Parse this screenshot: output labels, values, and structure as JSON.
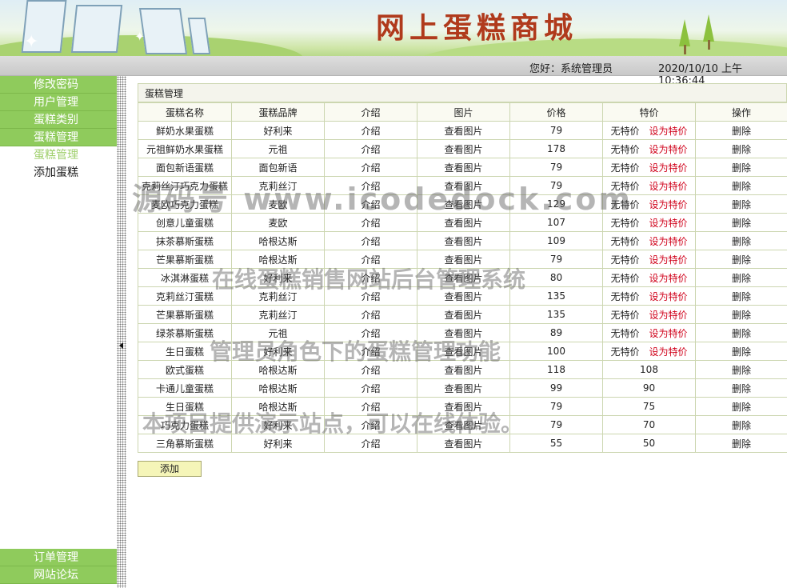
{
  "header": {
    "site_title": "网上蛋糕商城",
    "greeting": "您好：系统管理员",
    "datetime": "2020/10/10 上午10:36:44"
  },
  "sidebar": {
    "items": [
      {
        "label": "修改密码"
      },
      {
        "label": "用户管理"
      },
      {
        "label": "蛋糕类别"
      },
      {
        "label": "蛋糕管理"
      }
    ],
    "subitems": [
      {
        "label": "蛋糕管理",
        "active": true
      },
      {
        "label": "添加蛋糕",
        "active": false
      }
    ],
    "bottom_items": [
      {
        "label": "订单管理"
      },
      {
        "label": "网站论坛"
      }
    ]
  },
  "panel": {
    "title": "蛋糕管理",
    "columns": [
      "蛋糕名称",
      "蛋糕品牌",
      "介绍",
      "图片",
      "价格",
      "特价",
      "操作"
    ],
    "intro_link": "介绍",
    "image_link": "查看图片",
    "no_special": "无特价",
    "set_special": "设为特价",
    "delete_label": "删除",
    "rows": [
      {
        "name": "鲜奶水果蛋糕",
        "brand": "好利来",
        "price": "79",
        "special": ""
      },
      {
        "name": "元祖鲜奶水果蛋糕",
        "brand": "元祖",
        "price": "178",
        "special": ""
      },
      {
        "name": "面包新语蛋糕",
        "brand": "面包新语",
        "price": "79",
        "special": ""
      },
      {
        "name": "克莉丝汀巧克力蛋糕",
        "brand": "克莉丝汀",
        "price": "79",
        "special": ""
      },
      {
        "name": "麦欧巧克力蛋糕",
        "brand": "麦欧",
        "price": "129",
        "special": ""
      },
      {
        "name": "创意儿童蛋糕",
        "brand": "麦欧",
        "price": "107",
        "special": ""
      },
      {
        "name": "抹茶慕斯蛋糕",
        "brand": "哈根达斯",
        "price": "109",
        "special": ""
      },
      {
        "name": "芒果慕斯蛋糕",
        "brand": "哈根达斯",
        "price": "79",
        "special": ""
      },
      {
        "name": "冰淇淋蛋糕",
        "brand": "好利来",
        "price": "80",
        "special": ""
      },
      {
        "name": "克莉丝汀蛋糕",
        "brand": "克莉丝汀",
        "price": "135",
        "special": ""
      },
      {
        "name": "芒果慕斯蛋糕",
        "brand": "克莉丝汀",
        "price": "135",
        "special": ""
      },
      {
        "name": "绿茶慕斯蛋糕",
        "brand": "元祖",
        "price": "89",
        "special": ""
      },
      {
        "name": "生日蛋糕",
        "brand": "好利来",
        "price": "100",
        "special": ""
      },
      {
        "name": "欧式蛋糕",
        "brand": "哈根达斯",
        "price": "118",
        "special": "108"
      },
      {
        "name": "卡通儿童蛋糕",
        "brand": "哈根达斯",
        "price": "99",
        "special": "90"
      },
      {
        "name": "生日蛋糕",
        "brand": "哈根达斯",
        "price": "79",
        "special": "75"
      },
      {
        "name": "巧克力蛋糕",
        "brand": "好利来",
        "price": "79",
        "special": "70"
      },
      {
        "name": "三角慕斯蛋糕",
        "brand": "好利来",
        "price": "55",
        "special": "50"
      }
    ],
    "add_button": "添加"
  },
  "watermark": {
    "line1": "源码号 www.icodedock.com",
    "line2": "在线蛋糕销售网站后台管理系统",
    "line3": "管理员角色下的蛋糕管理功能",
    "line4": "本项目提供演示站点，可以在线体验。"
  }
}
